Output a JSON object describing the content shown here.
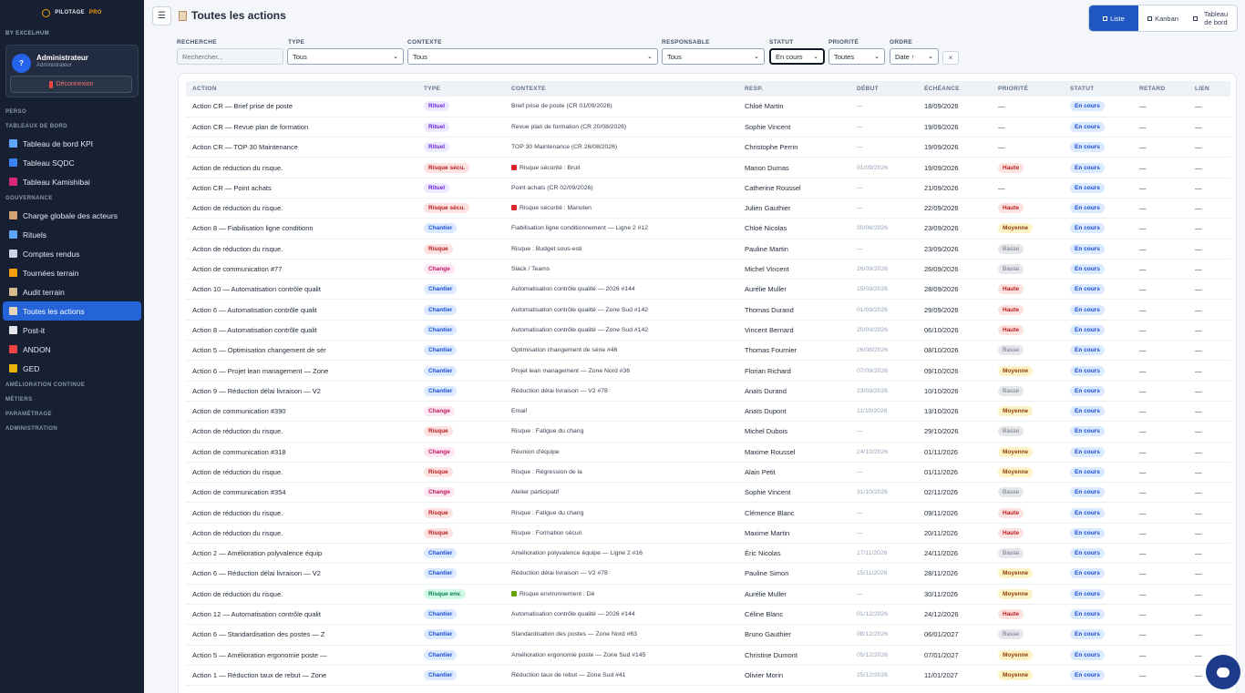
{
  "brand": {
    "name": "PILOTAGE",
    "suffix": "PRO",
    "byline": "BY EXCELHUM"
  },
  "user": {
    "initial": "?",
    "name": "Administrateur",
    "role": "Administrateur",
    "logout_label": "Déconnexion"
  },
  "sidebar": {
    "sections": {
      "perso": "PERSO",
      "tableaux": "TABLEAUX DE BORD",
      "gouvernance": "GOUVERNANCE",
      "amelioration": "AMÉLIORATION CONTINUE",
      "metiers": "MÉTIERS",
      "parametrage": "PARAMÉTRAGE",
      "administration": "ADMINISTRATION"
    },
    "dashboards": [
      {
        "label": "Tableau de bord KPI",
        "icon": "bar-chart-icon",
        "color": "#60a5fa"
      },
      {
        "label": "Tableau SQDC",
        "icon": "blue-square-icon",
        "color": "#3b82f6"
      },
      {
        "label": "Tableau Kamishibai",
        "icon": "kamishibai-icon",
        "color": "#db2777"
      }
    ],
    "governance": [
      {
        "label": "Charge globale des acteurs",
        "icon": "balance-icon",
        "color": "#d4a373"
      },
      {
        "label": "Rituels",
        "icon": "calendar-icon",
        "color": "#60a5fa"
      },
      {
        "label": "Comptes rendus",
        "icon": "notes-icon",
        "color": "#cbd5e1"
      },
      {
        "label": "Tournées terrain",
        "icon": "walking-icon",
        "color": "#f59e0b"
      },
      {
        "label": "Audit terrain",
        "icon": "clipboard-icon",
        "color": "#d6b98c"
      },
      {
        "label": "Toutes les actions",
        "icon": "clipboard-list-icon",
        "color": "#e8d6b8"
      },
      {
        "label": "Post-it",
        "icon": "sticky-note-icon",
        "color": "#e5e7eb"
      },
      {
        "label": "ANDON",
        "icon": "andon-light-icon",
        "color": "#ef4444"
      },
      {
        "label": "GED",
        "icon": "folder-icon",
        "color": "#eab308"
      }
    ]
  },
  "header": {
    "menu_glyph": "☰",
    "title": "Toutes les actions"
  },
  "views": [
    {
      "label": "Liste",
      "active": true
    },
    {
      "label": "Kanban",
      "active": false
    },
    {
      "label": "Tableau de bord",
      "active": false
    }
  ],
  "filters": {
    "search": {
      "label": "RECHERCHE",
      "placeholder": "Rechercher..."
    },
    "type": {
      "label": "TYPE",
      "value": "Tous"
    },
    "contexte": {
      "label": "CONTEXTE",
      "value": "Tous"
    },
    "responsable": {
      "label": "RESPONSABLE",
      "value": "Tous"
    },
    "statut": {
      "label": "STATUT",
      "value": "En cours"
    },
    "priorite": {
      "label": "PRIORITÉ",
      "value": "Toutes"
    },
    "ordre": {
      "label": "ORDRE",
      "value": "Date ↑"
    },
    "clear_glyph": "×"
  },
  "table": {
    "columns": [
      "ACTION",
      "TYPE",
      "CONTEXTE",
      "RESP.",
      "DÉBUT",
      "ÉCHÉANCE",
      "PRIORITÉ",
      "STATUT",
      "RETARD",
      "LIEN"
    ],
    "rows": [
      {
        "action": "Action CR — Brief prise de poste",
        "type": "Rituel",
        "tc": "rituel",
        "ctx": "Brief prise de poste (CR 01/09/2026)",
        "ci": "",
        "resp": "Chloé Martin",
        "debut": "—",
        "ech": "18/09/2026",
        "prio": "—",
        "pc": "",
        "statut": "En cours",
        "retard": "—",
        "lien": "—"
      },
      {
        "action": "Action CR — Revue plan de formation",
        "type": "Rituel",
        "tc": "rituel",
        "ctx": "Revue plan de formation (CR 20/08/2026)",
        "ci": "",
        "resp": "Sophie Vincent",
        "debut": "—",
        "ech": "19/09/2026",
        "prio": "—",
        "pc": "",
        "statut": "En cours",
        "retard": "—",
        "lien": "—"
      },
      {
        "action": "Action CR — TOP 30 Maintenance",
        "type": "Rituel",
        "tc": "rituel",
        "ctx": "TOP 30 Maintenance (CR 26/08/2026)",
        "ci": "",
        "resp": "Christophe Perrin",
        "debut": "—",
        "ech": "19/09/2026",
        "prio": "—",
        "pc": "",
        "statut": "En cours",
        "retard": "—",
        "lien": "—"
      },
      {
        "action": "Action de réduction du risque.",
        "type": "Risque sécu.",
        "tc": "risque",
        "ctx": "Risque sécurité : Bruit",
        "ci": "#dc2626",
        "resp": "Manon Dumas",
        "debut": "01/09/2026",
        "ech": "19/09/2026",
        "prio": "Haute",
        "pc": "haute",
        "statut": "En cours",
        "retard": "—",
        "lien": "—"
      },
      {
        "action": "Action CR — Point achats",
        "type": "Rituel",
        "tc": "rituel",
        "ctx": "Point achats (CR 02/09/2026)",
        "ci": "",
        "resp": "Catherine Roussel",
        "debut": "—",
        "ech": "21/09/2026",
        "prio": "—",
        "pc": "",
        "statut": "En cours",
        "retard": "—",
        "lien": "—"
      },
      {
        "action": "Action de réduction du risque.",
        "type": "Risque sécu.",
        "tc": "risque",
        "ctx": "Risque sécurité : Manuten",
        "ci": "#dc2626",
        "resp": "Julien Gauthier",
        "debut": "—",
        "ech": "22/09/2026",
        "prio": "Haute",
        "pc": "haute",
        "statut": "En cours",
        "retard": "—",
        "lien": "—"
      },
      {
        "action": "Action 8 — Fiabilisation ligne conditionn",
        "type": "Chantier",
        "tc": "chantier",
        "ctx": "Fiabilisation ligne conditionnement — Ligne 2 #12",
        "ci": "",
        "resp": "Chloé Nicolas",
        "debut": "30/08/2026",
        "ech": "23/09/2026",
        "prio": "Moyenne",
        "pc": "moyenne",
        "statut": "En cours",
        "retard": "—",
        "lien": "—"
      },
      {
        "action": "Action de réduction du risque.",
        "type": "Risque",
        "tc": "risque",
        "ctx": "Risque : Budget sous-esti",
        "ci": "",
        "resp": "Pauline Martin",
        "debut": "—",
        "ech": "23/09/2026",
        "prio": "Basse",
        "pc": "basse",
        "statut": "En cours",
        "retard": "—",
        "lien": "—"
      },
      {
        "action": "Action de communication #77",
        "type": "Change",
        "tc": "change",
        "ctx": "Slack / Teams",
        "ci": "",
        "resp": "Michel Vincent",
        "debut": "26/09/2026",
        "ech": "26/09/2026",
        "prio": "Basse",
        "pc": "basse",
        "statut": "En cours",
        "retard": "—",
        "lien": "—"
      },
      {
        "action": "Action 10 — Automatisation contrôle qualit",
        "type": "Chantier",
        "tc": "chantier",
        "ctx": "Automatisation contrôle qualité — 2026 #144",
        "ci": "",
        "resp": "Aurélie Muller",
        "debut": "15/09/2026",
        "ech": "28/09/2026",
        "prio": "Haute",
        "pc": "haute",
        "statut": "En cours",
        "retard": "—",
        "lien": "—"
      },
      {
        "action": "Action 6 — Automatisation contrôle qualit",
        "type": "Chantier",
        "tc": "chantier",
        "ctx": "Automatisation contrôle qualité — Zone Sud #142",
        "ci": "",
        "resp": "Thomas Durand",
        "debut": "01/09/2026",
        "ech": "29/09/2026",
        "prio": "Haute",
        "pc": "haute",
        "statut": "En cours",
        "retard": "—",
        "lien": "—"
      },
      {
        "action": "Action 8 — Automatisation contrôle qualit",
        "type": "Chantier",
        "tc": "chantier",
        "ctx": "Automatisation contrôle qualité — Zone Sud #142",
        "ci": "",
        "resp": "Vincent Bernard",
        "debut": "20/09/2026",
        "ech": "06/10/2026",
        "prio": "Haute",
        "pc": "haute",
        "statut": "En cours",
        "retard": "—",
        "lien": "—"
      },
      {
        "action": "Action 5 — Optimisation changement de sér",
        "type": "Chantier",
        "tc": "chantier",
        "ctx": "Optimisation changement de série #46",
        "ci": "",
        "resp": "Thomas Fournier",
        "debut": "26/08/2026",
        "ech": "08/10/2026",
        "prio": "Basse",
        "pc": "basse",
        "statut": "En cours",
        "retard": "—",
        "lien": "—"
      },
      {
        "action": "Action 6 — Projet lean management — Zone",
        "type": "Chantier",
        "tc": "chantier",
        "ctx": "Projet lean management — Zone Nord #36",
        "ci": "",
        "resp": "Florian Richard",
        "debut": "07/09/2026",
        "ech": "09/10/2026",
        "prio": "Moyenne",
        "pc": "moyenne",
        "statut": "En cours",
        "retard": "—",
        "lien": "—"
      },
      {
        "action": "Action 9 — Réduction délai livraison — V2",
        "type": "Chantier",
        "tc": "chantier",
        "ctx": "Réduction délai livraison — V2 #78",
        "ci": "",
        "resp": "Anaïs Durand",
        "debut": "23/09/2026",
        "ech": "10/10/2026",
        "prio": "Basse",
        "pc": "basse",
        "statut": "En cours",
        "retard": "—",
        "lien": "—"
      },
      {
        "action": "Action de communication #390",
        "type": "Change",
        "tc": "change",
        "ctx": "Email",
        "ci": "",
        "resp": "Anaïs Dupont",
        "debut": "11/10/2026",
        "ech": "13/10/2026",
        "prio": "Moyenne",
        "pc": "moyenne",
        "statut": "En cours",
        "retard": "—",
        "lien": "—"
      },
      {
        "action": "Action de réduction du risque.",
        "type": "Risque",
        "tc": "risque",
        "ctx": "Risque : Fatigue du chang",
        "ci": "",
        "resp": "Michel Dubois",
        "debut": "—",
        "ech": "29/10/2026",
        "prio": "Basse",
        "pc": "basse",
        "statut": "En cours",
        "retard": "—",
        "lien": "—"
      },
      {
        "action": "Action de communication #318",
        "type": "Change",
        "tc": "change",
        "ctx": "Réunion d'équipe",
        "ci": "",
        "resp": "Maxime Roussel",
        "debut": "24/10/2026",
        "ech": "01/11/2026",
        "prio": "Moyenne",
        "pc": "moyenne",
        "statut": "En cours",
        "retard": "—",
        "lien": "—"
      },
      {
        "action": "Action de réduction du risque.",
        "type": "Risque",
        "tc": "risque",
        "ctx": "Risque : Régression de la",
        "ci": "",
        "resp": "Alain Petit",
        "debut": "—",
        "ech": "01/11/2026",
        "prio": "Moyenne",
        "pc": "moyenne",
        "statut": "En cours",
        "retard": "—",
        "lien": "—"
      },
      {
        "action": "Action de communication #354",
        "type": "Change",
        "tc": "change",
        "ctx": "Atelier participatif",
        "ci": "",
        "resp": "Sophie Vincent",
        "debut": "31/10/2026",
        "ech": "02/11/2026",
        "prio": "Basse",
        "pc": "basse",
        "statut": "En cours",
        "retard": "—",
        "lien": "—"
      },
      {
        "action": "Action de réduction du risque.",
        "type": "Risque",
        "tc": "risque",
        "ctx": "Risque : Fatigue du chang",
        "ci": "",
        "resp": "Clémence Blanc",
        "debut": "—",
        "ech": "09/11/2026",
        "prio": "Haute",
        "pc": "haute",
        "statut": "En cours",
        "retard": "—",
        "lien": "—"
      },
      {
        "action": "Action de réduction du risque.",
        "type": "Risque",
        "tc": "risque",
        "ctx": "Risque : Formation sécuri",
        "ci": "",
        "resp": "Maxime Martin",
        "debut": "—",
        "ech": "20/11/2026",
        "prio": "Haute",
        "pc": "haute",
        "statut": "En cours",
        "retard": "—",
        "lien": "—"
      },
      {
        "action": "Action 2 — Amélioration polyvalence équip",
        "type": "Chantier",
        "tc": "chantier",
        "ctx": "Amélioration polyvalence équipe — Ligne 2 #16",
        "ci": "",
        "resp": "Éric Nicolas",
        "debut": "17/11/2026",
        "ech": "24/11/2026",
        "prio": "Basse",
        "pc": "basse",
        "statut": "En cours",
        "retard": "—",
        "lien": "—"
      },
      {
        "action": "Action 6 — Réduction délai livraison — V2",
        "type": "Chantier",
        "tc": "chantier",
        "ctx": "Réduction délai livraison — V2 #78",
        "ci": "",
        "resp": "Pauline Simon",
        "debut": "15/11/2026",
        "ech": "28/11/2026",
        "prio": "Moyenne",
        "pc": "moyenne",
        "statut": "En cours",
        "retard": "—",
        "lien": "—"
      },
      {
        "action": "Action de réduction du risque.",
        "type": "Risque env.",
        "tc": "env",
        "ctx": "Risque environnement : Dé",
        "ci": "#65a30d",
        "resp": "Aurélie Muller",
        "debut": "—",
        "ech": "30/11/2026",
        "prio": "Moyenne",
        "pc": "moyenne",
        "statut": "En cours",
        "retard": "—",
        "lien": "—"
      },
      {
        "action": "Action 12 — Automatisation contrôle qualit",
        "type": "Chantier",
        "tc": "chantier",
        "ctx": "Automatisation contrôle qualité — 2026 #144",
        "ci": "",
        "resp": "Céline Blanc",
        "debut": "01/12/2026",
        "ech": "24/12/2026",
        "prio": "Haute",
        "pc": "haute",
        "statut": "En cours",
        "retard": "—",
        "lien": "—"
      },
      {
        "action": "Action 6 — Standardisation des postes — Z",
        "type": "Chantier",
        "tc": "chantier",
        "ctx": "Standardisation des postes — Zone Nord #63",
        "ci": "",
        "resp": "Bruno Gauthier",
        "debut": "08/12/2026",
        "ech": "06/01/2027",
        "prio": "Basse",
        "pc": "basse",
        "statut": "En cours",
        "retard": "—",
        "lien": "—"
      },
      {
        "action": "Action 5 — Amélioration ergonomie poste —",
        "type": "Chantier",
        "tc": "chantier",
        "ctx": "Amélioration ergonomie poste — Zone Sud #145",
        "ci": "",
        "resp": "Christine Dumont",
        "debut": "05/12/2026",
        "ech": "07/01/2027",
        "prio": "Moyenne",
        "pc": "moyenne",
        "statut": "En cours",
        "retard": "—",
        "lien": "—"
      },
      {
        "action": "Action 1 — Réduction taux de rebut — Zone",
        "type": "Chantier",
        "tc": "chantier",
        "ctx": "Réduction taux de rebut — Zone Sud #41",
        "ci": "",
        "resp": "Olivier Morin",
        "debut": "25/12/2026",
        "ech": "11/01/2027",
        "prio": "Moyenne",
        "pc": "moyenne",
        "statut": "En cours",
        "retard": "—",
        "lien": "—"
      }
    ]
  },
  "chat": {
    "icon": "chat-bubble-icon"
  }
}
